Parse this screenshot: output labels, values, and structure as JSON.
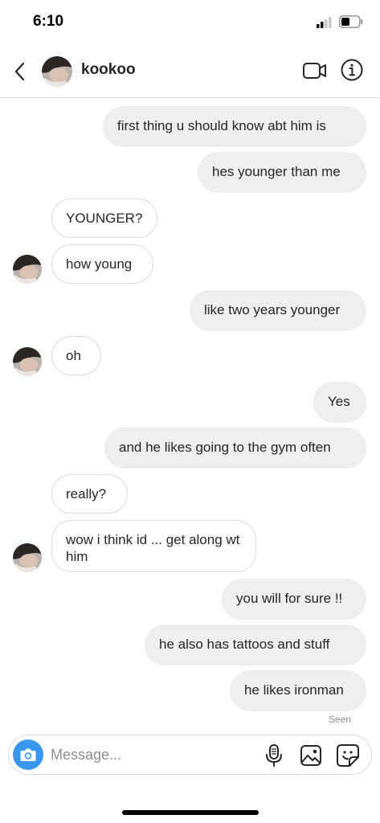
{
  "status_bar": {
    "time": "6:10"
  },
  "header": {
    "name": "kookoo",
    "icons": [
      "back-icon",
      "video-call-icon",
      "info-icon"
    ]
  },
  "messages": [
    {
      "side": "sent",
      "text": "first thing u should know abt him is"
    },
    {
      "side": "sent",
      "text": "hes younger than me"
    },
    {
      "side": "received",
      "text": "YOUNGER?"
    },
    {
      "side": "received",
      "text": "how young"
    },
    {
      "side": "sent",
      "text": "like two years younger"
    },
    {
      "side": "received",
      "text": "oh"
    },
    {
      "side": "sent",
      "text": "Yes"
    },
    {
      "side": "sent",
      "text": "and he likes going to the gym often"
    },
    {
      "side": "received",
      "text": "really?"
    },
    {
      "side": "received",
      "text": "wow i think id ... get along wt him"
    },
    {
      "side": "sent",
      "text": "you will for sure !!"
    },
    {
      "side": "sent",
      "text": "he also has tattoos and stuff"
    },
    {
      "side": "sent",
      "text": "he likes ironman"
    }
  ],
  "seen_label": "Seen",
  "composer": {
    "placeholder": "Message...",
    "icons": [
      "camera-icon",
      "microphone-icon",
      "gallery-icon",
      "sticker-icon"
    ]
  },
  "colors": {
    "sent_bubble": "#efefef",
    "received_border": "#dbdbdb",
    "camera_button": "#3897f0",
    "muted_text": "#8e8e8e"
  }
}
